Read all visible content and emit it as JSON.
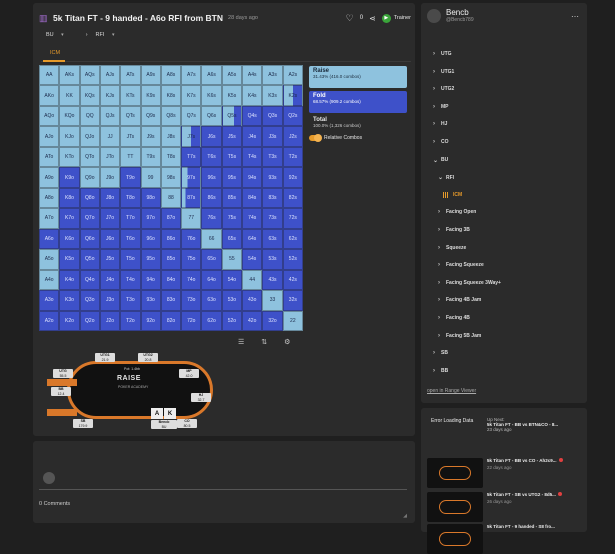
{
  "header": {
    "title": "5k Titan FT - 9 handed - A6o RFI from BTN",
    "ago": "28 days ago",
    "likes": "0",
    "trainer_label": "Trainer"
  },
  "breadcrumbs": {
    "position": "BU",
    "action": "RFI"
  },
  "tab": "ICM",
  "legend": {
    "raise_label": "Raise",
    "raise_detail": "31.43% (416.0 combos)",
    "fold_label": "Fold",
    "fold_detail": "68.57% (909.2 combos)",
    "total_label": "Total",
    "total_detail": "100.0% (1,326 combos)",
    "relative_combos_label": "Relative Combos",
    "raise_color": "#8ec2de",
    "fold_color": "#3e51c9"
  },
  "grid": {
    "hands": [
      [
        "AA",
        "AKs",
        "AQs",
        "AJs",
        "ATs",
        "A9s",
        "A8s",
        "A7s",
        "A6s",
        "A5s",
        "A4s",
        "A3s",
        "A2s"
      ],
      [
        "AKo",
        "KK",
        "KQs",
        "KJs",
        "KTs",
        "K9s",
        "K8s",
        "K7s",
        "K6s",
        "K5s",
        "K4s",
        "K3s",
        "K2s"
      ],
      [
        "AQo",
        "KQo",
        "QQ",
        "QJs",
        "QTs",
        "Q9s",
        "Q8s",
        "Q7s",
        "Q6s",
        "Q5s",
        "Q4s",
        "Q3s",
        "Q2s"
      ],
      [
        "AJo",
        "KJo",
        "QJo",
        "JJ",
        "JTs",
        "J9s",
        "J8s",
        "J7s",
        "J6s",
        "J5s",
        "J4s",
        "J3s",
        "J2s"
      ],
      [
        "ATo",
        "KTo",
        "QTo",
        "JTo",
        "TT",
        "T9s",
        "T8s",
        "T7s",
        "T6s",
        "T5s",
        "T4s",
        "T3s",
        "T2s"
      ],
      [
        "A9o",
        "K9o",
        "Q9o",
        "J9o",
        "T9o",
        "99",
        "98s",
        "97s",
        "96s",
        "95s",
        "94s",
        "93s",
        "92s"
      ],
      [
        "A8o",
        "K8o",
        "Q8o",
        "J8o",
        "T8o",
        "98o",
        "88",
        "87s",
        "86s",
        "85s",
        "84s",
        "83s",
        "82s"
      ],
      [
        "A7o",
        "K7o",
        "Q7o",
        "J7o",
        "T7o",
        "97o",
        "87o",
        "77",
        "76s",
        "75s",
        "74s",
        "73s",
        "72s"
      ],
      [
        "A6o",
        "K6o",
        "Q6o",
        "J6o",
        "T6o",
        "96o",
        "86o",
        "76o",
        "66",
        "65s",
        "64s",
        "63s",
        "62s"
      ],
      [
        "A5o",
        "K5o",
        "Q5o",
        "J5o",
        "T5o",
        "95o",
        "85o",
        "75o",
        "65o",
        "55",
        "54s",
        "53s",
        "52s"
      ],
      [
        "A4o",
        "K4o",
        "Q4o",
        "J4o",
        "T4o",
        "94o",
        "84o",
        "74o",
        "64o",
        "54o",
        "44",
        "43s",
        "42s"
      ],
      [
        "A3o",
        "K3o",
        "Q3o",
        "J3o",
        "T3o",
        "93o",
        "83o",
        "73o",
        "63o",
        "53o",
        "43o",
        "33",
        "32s"
      ],
      [
        "A2o",
        "K2o",
        "Q2o",
        "J2o",
        "T2o",
        "92o",
        "82o",
        "72o",
        "62o",
        "52o",
        "42o",
        "32o",
        "22"
      ]
    ],
    "raise_fraction": [
      [
        1,
        1,
        1,
        1,
        1,
        1,
        1,
        1,
        1,
        1,
        1,
        1,
        1
      ],
      [
        1,
        1,
        1,
        1,
        1,
        1,
        1,
        1,
        1,
        1,
        1,
        1,
        0.5
      ],
      [
        1,
        1,
        1,
        1,
        1,
        1,
        1,
        1,
        1,
        0.6,
        0,
        0,
        0
      ],
      [
        1,
        1,
        1,
        1,
        1,
        1,
        1,
        0.5,
        0,
        0,
        0,
        0,
        0
      ],
      [
        1,
        1,
        1,
        1,
        1,
        1,
        1,
        0,
        0,
        0,
        0,
        0,
        0
      ],
      [
        1,
        0,
        1,
        1,
        0,
        1,
        1,
        0.3,
        0,
        0,
        0,
        0,
        0
      ],
      [
        1,
        0,
        0,
        0,
        0,
        0,
        1,
        0.2,
        0,
        0,
        0,
        0,
        0
      ],
      [
        1,
        0,
        0,
        0,
        0,
        0,
        0,
        1,
        0,
        0,
        0,
        0,
        0
      ],
      [
        0,
        0,
        0,
        0,
        0,
        0,
        0,
        0,
        1,
        0,
        0,
        0,
        0
      ],
      [
        1,
        0,
        0,
        0,
        0,
        0,
        0,
        0,
        0,
        1,
        0,
        0,
        0
      ],
      [
        1,
        0,
        0,
        0,
        0,
        0,
        0,
        0,
        0,
        0,
        1,
        0,
        0
      ],
      [
        0,
        0,
        0,
        0,
        0,
        0,
        0,
        0,
        0,
        0,
        0,
        1,
        0
      ],
      [
        0,
        0,
        0,
        0,
        0,
        0,
        0,
        0,
        0,
        0,
        0,
        0,
        1
      ]
    ]
  },
  "table": {
    "logo": "RAISE",
    "logo_sub": "POKER ACADEMY",
    "pot": "Pot: 1.4bb",
    "seats": [
      {
        "pos": "UTG1",
        "stack": "21.9"
      },
      {
        "pos": "UTG2",
        "stack": "20.8"
      },
      {
        "pos": "UTG",
        "stack": "55.5"
      },
      {
        "pos": "MP",
        "stack": "42.0"
      },
      {
        "pos": "HJ",
        "stack": "32.7"
      },
      {
        "pos": "CO",
        "stack": "80.5"
      },
      {
        "pos": "BB",
        "stack": "12.4"
      },
      {
        "pos": "SB",
        "stack": "179.9"
      },
      {
        "pos": "BU",
        "stack": "30.8"
      }
    ],
    "hero_cards": [
      "A",
      "K"
    ],
    "hero_name": "Bencb"
  },
  "comments": {
    "count_label": "0 Comments"
  },
  "sidebar": {
    "user_name": "Bencb",
    "user_handle": "@Bencb789",
    "tree": [
      {
        "label": "UTG",
        "depth": 0,
        "chev": "›"
      },
      {
        "label": "UTG1",
        "depth": 0,
        "chev": "›"
      },
      {
        "label": "UTG2",
        "depth": 0,
        "chev": "›"
      },
      {
        "label": "MP",
        "depth": 0,
        "chev": "›"
      },
      {
        "label": "HJ",
        "depth": 0,
        "chev": "›"
      },
      {
        "label": "CO",
        "depth": 0,
        "chev": "›"
      },
      {
        "label": "BU",
        "depth": 0,
        "chev": "⌄"
      },
      {
        "label": "RFI",
        "depth": 1,
        "chev": "⌄"
      },
      {
        "label": "ICM",
        "depth": 2,
        "chev": "",
        "active": true
      },
      {
        "label": "Facing Open",
        "depth": 1,
        "chev": "›"
      },
      {
        "label": "Facing 3B",
        "depth": 1,
        "chev": "›"
      },
      {
        "label": "Squeeze",
        "depth": 1,
        "chev": "›"
      },
      {
        "label": "Facing Squeeze",
        "depth": 1,
        "chev": "›"
      },
      {
        "label": "Facing Squeeze 3Way+",
        "depth": 1,
        "chev": "›"
      },
      {
        "label": "Facing 4B Jam",
        "depth": 1,
        "chev": "›"
      },
      {
        "label": "Facing 4B",
        "depth": 1,
        "chev": "›"
      },
      {
        "label": "Facing 5B Jam",
        "depth": 1,
        "chev": "›"
      },
      {
        "label": "SB",
        "depth": 0,
        "chev": "›"
      },
      {
        "label": "BB",
        "depth": 0,
        "chev": "›"
      }
    ],
    "open_link": "open in Range Viewer"
  },
  "up_next": {
    "error": "Error Loading Data",
    "label": "Up Next:",
    "first_title": "5k Titan FT - BB vs BTN&CO - 8...",
    "first_date": "23 days ago",
    "videos": [
      {
        "title": "5k Titan FT - BB vs CO - Ah2c9...",
        "date": "22 days ago"
      },
      {
        "title": "5k Titan FT - SB vs UTG2 - 8d5...",
        "date": "26 days ago"
      },
      {
        "title": "5k Titan FT - 9 handed - S8 fro...",
        "date": "28 days ago"
      }
    ]
  }
}
